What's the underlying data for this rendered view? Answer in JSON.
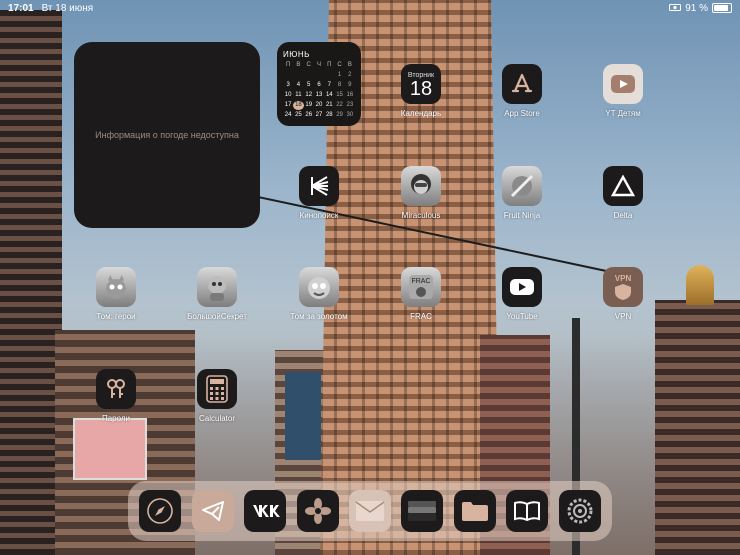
{
  "status_bar": {
    "time": "17:01",
    "date": "Вт 18 июня",
    "battery": "91 %"
  },
  "weather_widget": {
    "message": "Информация о погоде недоступна"
  },
  "calendar_widget": {
    "month": "ИЮНЬ",
    "weekdays": [
      "П",
      "В",
      "С",
      "Ч",
      "П",
      "С",
      "В"
    ],
    "weeks": [
      [
        "",
        "",
        "",
        "",
        "",
        "1",
        "2"
      ],
      [
        "3",
        "4",
        "5",
        "6",
        "7",
        "8",
        "9"
      ],
      [
        "10",
        "11",
        "12",
        "13",
        "14",
        "15",
        "16"
      ],
      [
        "17",
        "18",
        "19",
        "20",
        "21",
        "22",
        "23"
      ],
      [
        "24",
        "25",
        "26",
        "27",
        "28",
        "29",
        "30"
      ]
    ],
    "today": "18"
  },
  "apps": {
    "calendar": {
      "label": "Календарь",
      "weekday": "Вторник",
      "day": "18"
    },
    "appstore": {
      "label": "App Store"
    },
    "yt_kids": {
      "label": "YT Детям"
    },
    "kinopoisk": {
      "label": "Кинопоиск"
    },
    "miraculous": {
      "label": "Miraculous"
    },
    "fruitninja": {
      "label": "Fruit Ninja"
    },
    "delta": {
      "label": "Delta"
    },
    "tom_heroes": {
      "label": "Том: герои"
    },
    "bigsecret": {
      "label": "БольшойСекрет"
    },
    "tom_gold": {
      "label": "Том за золотом"
    },
    "frac": {
      "label": "FRAC"
    },
    "youtube": {
      "label": "YouTube"
    },
    "vpn": {
      "label": "VPN",
      "badge": "VPN"
    },
    "passwords": {
      "label": "Пароли"
    },
    "calculator": {
      "label": "Calculator"
    }
  },
  "dock": [
    "Safari",
    "Telegram",
    "VK",
    "Photos",
    "Mail",
    "Wallet",
    "Files",
    "Books",
    "Settings"
  ],
  "colors": {
    "widget_bg": "#1c1a1a",
    "accent": "#d7b3a0",
    "dock_bg": "#e1cdc3"
  }
}
